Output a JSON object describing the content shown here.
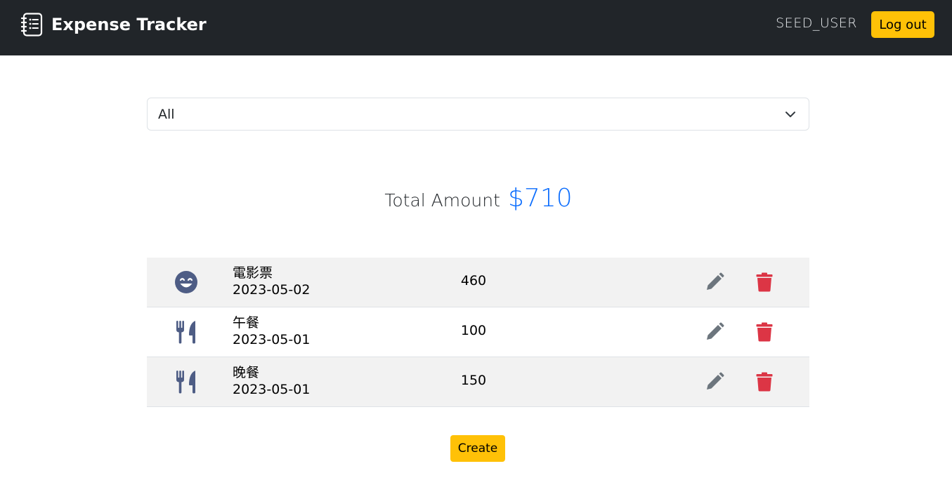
{
  "app": {
    "title": "Expense Tracker",
    "brand_icon": "notebook-list-icon"
  },
  "header": {
    "user": "SEED_USER",
    "logout_label": "Log out"
  },
  "filter": {
    "selected": "All",
    "icon": "chevron-down-icon"
  },
  "summary": {
    "label": "Total Amount",
    "amount": "$710",
    "accent_color": "#0d6efd"
  },
  "records": [
    {
      "name": "電影票",
      "date": "2023-05-02",
      "amount": "460",
      "category_icon": "smiley-face-icon"
    },
    {
      "name": "午餐",
      "date": "2023-05-01",
      "amount": "100",
      "category_icon": "utensils-icon"
    },
    {
      "name": "晚餐",
      "date": "2023-05-01",
      "amount": "150",
      "category_icon": "utensils-icon"
    }
  ],
  "actions": {
    "create_label": "Create",
    "edit_icon": "pencil-icon",
    "delete_icon": "trash-icon"
  },
  "colors": {
    "navbar": "#212529",
    "button_yellow": "#ffc107",
    "delete_red": "#dc3545",
    "edit_gray": "#6c757d",
    "category_icon": "#4e5d85"
  }
}
